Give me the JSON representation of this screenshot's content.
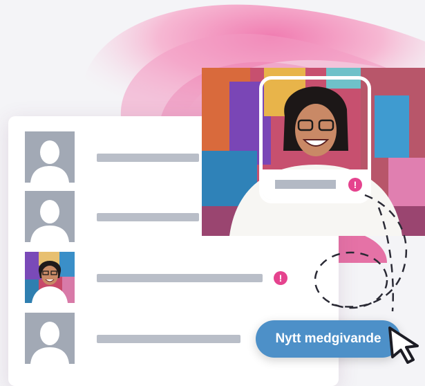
{
  "rows": [
    {
      "has_photo": false,
      "alert": false
    },
    {
      "has_photo": false,
      "alert": false
    },
    {
      "has_photo": true,
      "alert": true
    },
    {
      "has_photo": false,
      "alert": false
    }
  ],
  "profile_card": {
    "alert": true
  },
  "cta": {
    "label": "Nytt medgivande"
  },
  "alert_glyph": "!",
  "icons": {
    "placeholder_avatar": "person-silhouette-icon",
    "alert": "exclamation-icon",
    "pointer": "mouse-pointer-icon"
  },
  "colors": {
    "accent": "#e5438e",
    "button": "#4d90c8",
    "placeholder": "#a2a9b5",
    "line": "#b9bec8"
  }
}
